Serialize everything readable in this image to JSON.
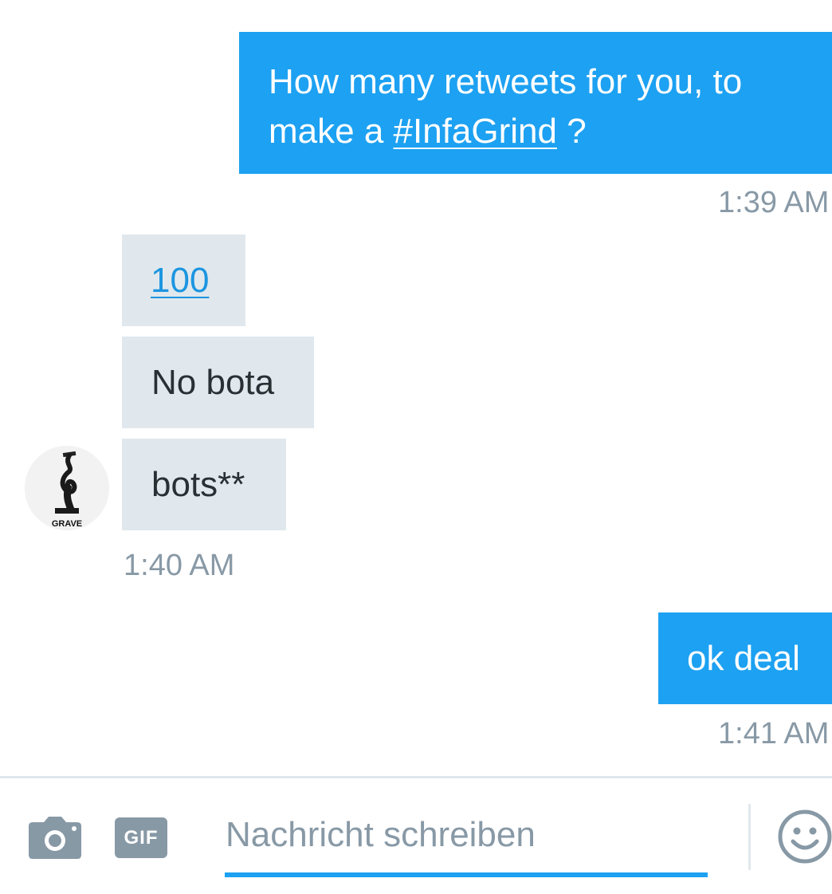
{
  "messages": {
    "outgoing_1": {
      "text_before": "How many retweets for you, to make a ",
      "hashtag": "#InfaGrind",
      "text_after": " ?",
      "time": "1:39 AM"
    },
    "incoming": {
      "items": [
        {
          "text": "100",
          "is_link": true
        },
        {
          "text": "No bota"
        },
        {
          "text": "bots**"
        }
      ],
      "avatar_caption": "GRAVE",
      "time": "1:40 AM"
    },
    "outgoing_2": {
      "text": "ok deal",
      "time": "1:41 AM"
    }
  },
  "composer": {
    "placeholder": "Nachricht schreiben",
    "gif_label": "GIF",
    "camera_icon": "camera-icon",
    "emoji_icon": "emoji-icon"
  },
  "colors": {
    "accent": "#1da1f2",
    "incoming_bubble": "#e1e8ed",
    "timestamp": "#8899a6",
    "link": "#1b95e0"
  }
}
